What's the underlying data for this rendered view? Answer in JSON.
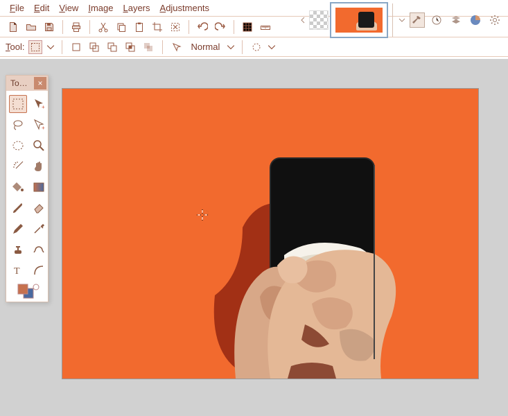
{
  "menubar": {
    "file": "File",
    "edit": "Edit",
    "view": "View",
    "image": "Image",
    "layers": "Layers",
    "adjustments": "Adjustments"
  },
  "toolopts": {
    "tool_label": "Tool:",
    "blend_mode": "Normal"
  },
  "toolbox": {
    "title": "To…"
  },
  "colors": {
    "accent": "#c6714e",
    "canvas_bg": "#f26a2e",
    "workspace_bg": "#d1d1d1",
    "palette_primary": "#c6714e",
    "palette_secondary": "#4a6aa0"
  },
  "tool_icons": [
    "rect-select",
    "move",
    "lasso",
    "move-precise",
    "ellipse-select",
    "zoom",
    "magic-wand",
    "pan-hand",
    "paint-bucket",
    "gradient",
    "paintbrush",
    "eraser",
    "pencil",
    "color-picker",
    "clone-stamp",
    "recolor",
    "text",
    "line-curve"
  ],
  "topright_icons": [
    "hammer",
    "history-clock",
    "layers-stack",
    "pie-chart",
    "settings-gear"
  ],
  "chart_data": null
}
